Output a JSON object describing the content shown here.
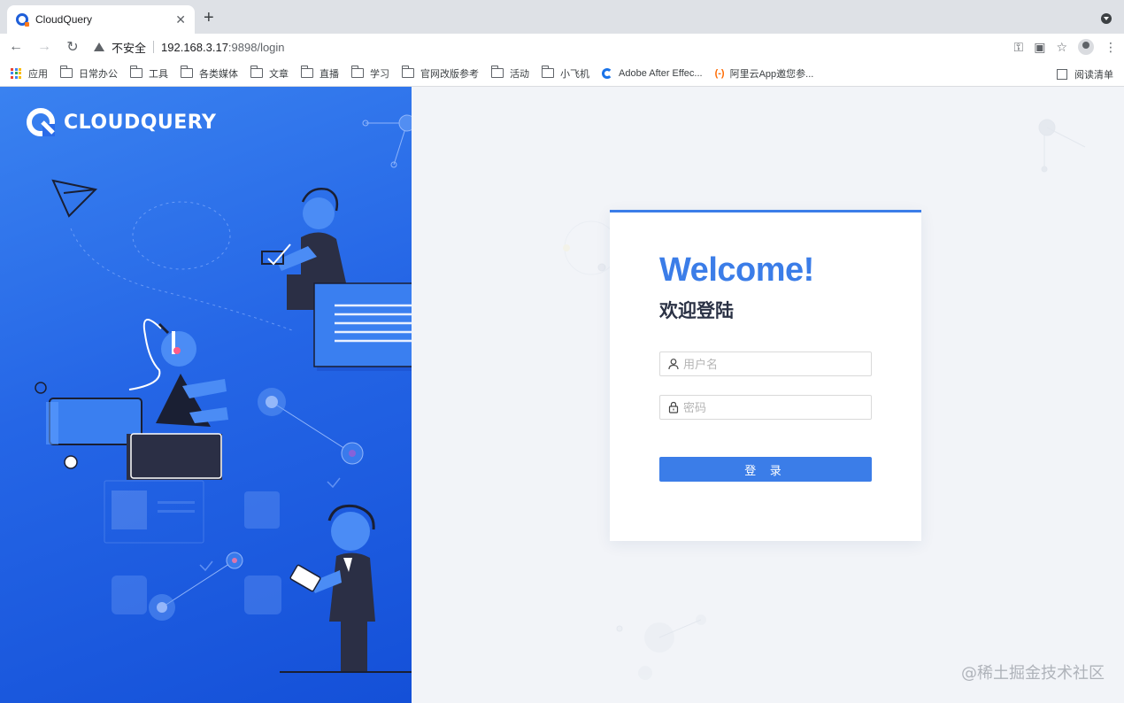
{
  "browser": {
    "tab_title": "CloudQuery",
    "security_label": "不安全",
    "url_host": "192.168.3.17",
    "url_rest": ":9898/login"
  },
  "bookmarks": {
    "apps": "应用",
    "items": [
      "日常办公",
      "工具",
      "各类媒体",
      "文章",
      "直播",
      "学习",
      "官网改版参考",
      "活动",
      "小飞机"
    ],
    "ae": "Adobe After Effec...",
    "aliyun": "阿里云App邀您参...",
    "aliyun_icon": "(-)",
    "reading_list": "阅读清单"
  },
  "brand": {
    "name": "CLOUDQUERY"
  },
  "login": {
    "welcome": "Welcome!",
    "subtitle": "欢迎登陆",
    "username_placeholder": "用户名",
    "password_placeholder": "密码",
    "submit_label": "登 录"
  },
  "watermark": "@稀土掘金技术社区",
  "colors": {
    "primary": "#3b7de8",
    "panel_blue": "#2566e6",
    "dark_figure": "#2b2f45"
  }
}
